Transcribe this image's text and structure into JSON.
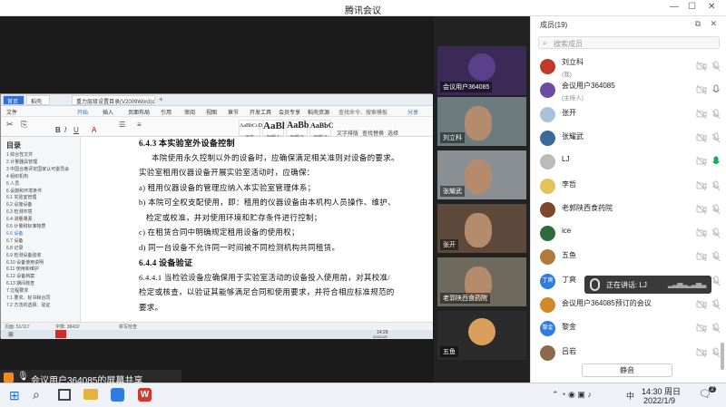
{
  "window": {
    "title": "腾讯会议"
  },
  "document": {
    "tabs": [
      "首页",
      "稻壳",
      "重力层级设置目录(V2009Word)docx"
    ],
    "menu": [
      "文件",
      "开始",
      "插入",
      "页面布局",
      "引用",
      "审阅",
      "视图",
      "章节",
      "开发工具",
      "会员专享",
      "稻壳资源"
    ],
    "search_label": "查找命令、搜索模板",
    "share_label": "分享",
    "styles": [
      {
        "sample": "AaBbCcDd",
        "name": "正文"
      },
      {
        "sample": "AaBl",
        "name": "标题 1"
      },
      {
        "sample": "AaBb",
        "name": "标题 2"
      },
      {
        "sample": "AaBbC",
        "name": "标题 3"
      }
    ],
    "ribbon_labels": [
      "文字排版",
      "查找替换",
      "选择"
    ],
    "toc_title": "目录",
    "toc_items": [
      "1 综合性文件",
      "2 计量器具管理",
      "3 中国合格评定国家认可委员会",
      "4 组织机构",
      "5 人员",
      "6 设施和环境条件",
      "6.1 实验室管理",
      "6.2 设施设备",
      "6.3 检测环境",
      "6.4 测量溯源",
      "6.5 计量和标准物质",
      "6.6 设备",
      "6.7 设备",
      "6.8 记录",
      "6.9 检测设备验收",
      "6.10 设备使用说明",
      "6.11 使用和维护",
      "6.12 设备档案",
      "6.13 期间核查",
      "7 过程要求",
      "7.1 要求、标书和合同",
      "7.2 方法的选择、验证"
    ],
    "lines": [
      "6.4.3 本实验室外设备控制",
      "本院使用永久控制以外的设备时，应确保满足相关准则对设备的要求。",
      "实验室租用仪器设备开展实验室活动时，应确保：",
      "a) 租用仪器设备的管理应纳入本实验室管理体系；",
      "b) 本院可全权支配使用，即：租用的仪器设备由本机构人员操作、维护、",
      "检定或校准，并对使用环境和贮存条件进行控制；",
      "c) 在租赁合同中明确规定租用设备的使用权；",
      "d) 同一台设备不允许同一时间被不同检测机构共同租赁。",
      "6.4.4 设备验证",
      "6.4.4.1 当检验设备应确保用于实验室活动的设备投入使用前，对其校准/",
      "检定或核查，以验证其能够满足合同和使用要求，并符合相应标准规范的",
      "要求。"
    ],
    "status_left": "页面: 51/117",
    "status_mid": "字数: 38432",
    "status_spell": "拼写检查",
    "task_time": "14:29",
    "task_date": "2022/1/9"
  },
  "share_banner": "会议用户364085的屏幕共享",
  "videos": [
    {
      "name": "会议用户364085",
      "color": "#3a2a55"
    },
    {
      "name": "刘立科",
      "color": "#6b7b7e"
    },
    {
      "name": "张耀武",
      "color": "#8a8f93"
    },
    {
      "name": "张开",
      "color": "#5d4a3c"
    },
    {
      "name": "老郭陕西食药院",
      "color": "#6e6a5e"
    },
    {
      "name": "五鱼",
      "color": "#2b2b2b"
    }
  ],
  "panel": {
    "title": "成员(19)",
    "search_placeholder": "搜索成员",
    "members": [
      {
        "name": "刘立科",
        "sub": "(我)",
        "color": "#c0392b",
        "mic": "off"
      },
      {
        "name": "会议用户364085",
        "sub": "(主持人)",
        "color": "#6d4c9f",
        "mic": "on"
      },
      {
        "name": "张开",
        "sub": "",
        "color": "#a9c4d8",
        "mic": "off"
      },
      {
        "name": "张耀武",
        "sub": "",
        "color": "#3b6b9a",
        "mic": "off"
      },
      {
        "name": "LJ",
        "sub": "",
        "color": "#bbb",
        "mic": "active"
      },
      {
        "name": "李哲",
        "sub": "",
        "color": "#e3c45a",
        "mic": "off"
      },
      {
        "name": "老郭陕西食药院",
        "sub": "",
        "color": "#7a4a2a",
        "mic": "off"
      },
      {
        "name": "ice",
        "sub": "",
        "color": "#2e6b3b",
        "mic": "off"
      },
      {
        "name": "五鱼",
        "sub": "",
        "color": "#b07b3a",
        "mic": "off"
      },
      {
        "name": "丁爽",
        "sub": "",
        "color": "#2f7de1",
        "mic": "off"
      },
      {
        "name": "会议用户364085预订的会议",
        "sub": "",
        "color": "#d08a2a",
        "mic": "off"
      },
      {
        "name": "黎金",
        "sub": "",
        "color": "#2f7de1",
        "mic": "off"
      },
      {
        "name": "吕岩",
        "sub": "",
        "color": "#8a6a4a",
        "mic": "off"
      }
    ],
    "avatar_text": {
      "丁爽": "丁爽",
      "黎金": "黎金"
    },
    "mute_all": "静音",
    "speaking_label": "正在讲话: LJ"
  },
  "taskbar": {
    "time": "14:30 周日",
    "date": "2022/1/9",
    "lang": "中",
    "notif_count": "2"
  }
}
